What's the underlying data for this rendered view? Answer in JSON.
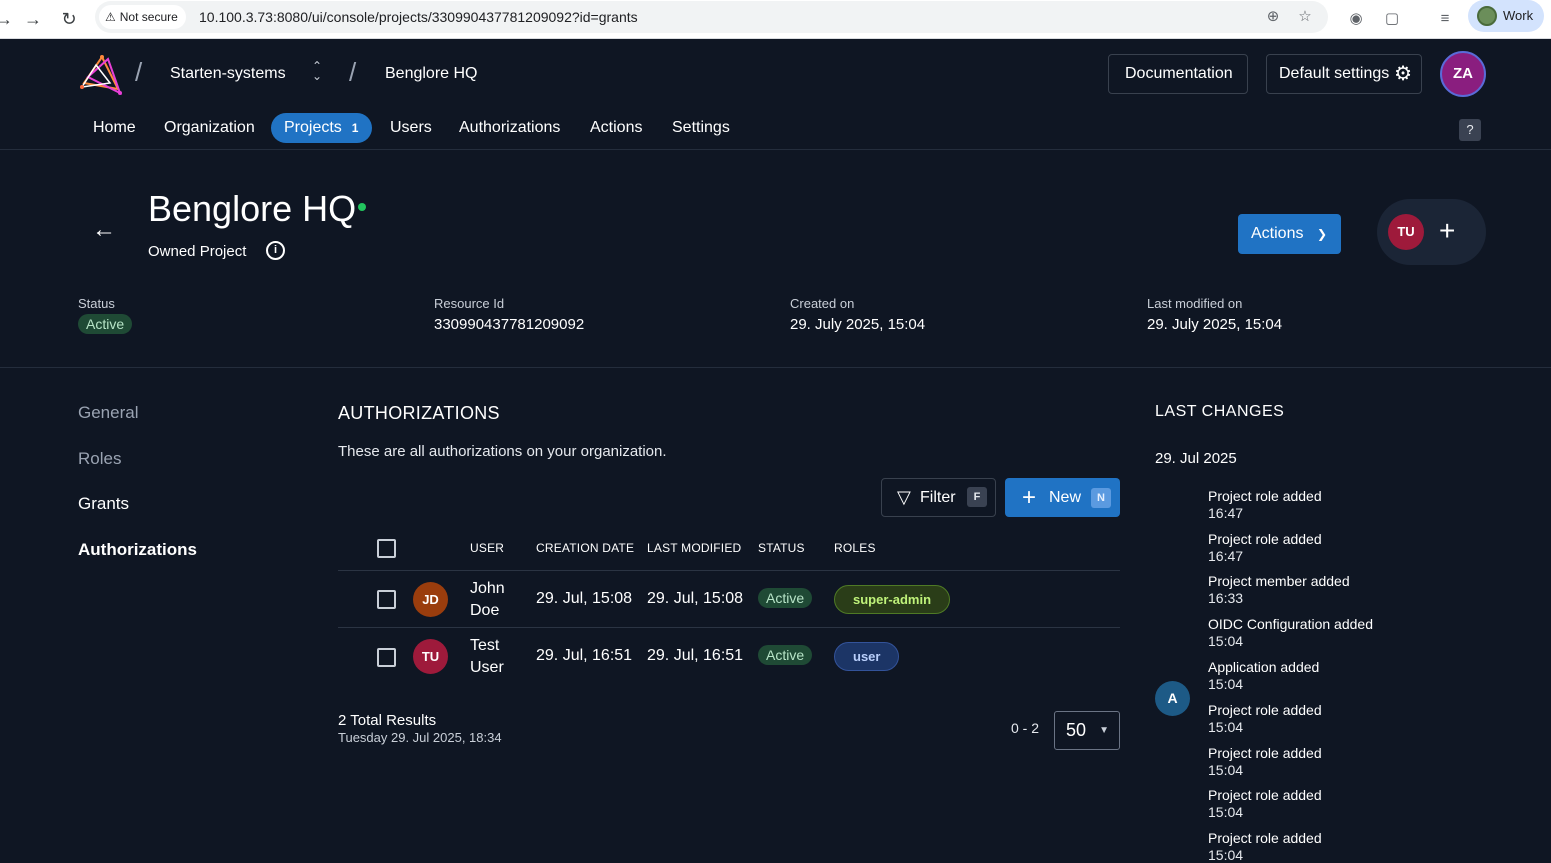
{
  "browser": {
    "security_label": "Not secure",
    "url": "10.100.3.73:8080/ui/console/projects/330990437781209092?id=grants",
    "profile_label": "Work"
  },
  "header": {
    "organization": "Starten-systems",
    "project": "Benglore HQ",
    "documentation_label": "Documentation",
    "default_settings_label": "Default settings",
    "user_initials": "ZA",
    "help_label": "?"
  },
  "mainnav": {
    "items": [
      {
        "label": "Home"
      },
      {
        "label": "Organization"
      },
      {
        "label": "Projects",
        "badge": "1"
      },
      {
        "label": "Users"
      },
      {
        "label": "Authorizations"
      },
      {
        "label": "Actions"
      },
      {
        "label": "Settings"
      }
    ]
  },
  "project": {
    "title": "Benglore HQ",
    "subtitle": "Owned Project",
    "actions_label": "Actions",
    "member_initials": "TU",
    "meta": {
      "status_label": "Status",
      "status_value": "Active",
      "resource_label": "Resource Id",
      "resource_value": "330990437781209092",
      "created_label": "Created on",
      "created_value": "29. July 2025, 15:04",
      "modified_label": "Last modified on",
      "modified_value": "29. July 2025, 15:04"
    }
  },
  "sidenav": {
    "items": [
      "General",
      "Roles",
      "Grants",
      "Authorizations"
    ]
  },
  "authorizations": {
    "title": "AUTHORIZATIONS",
    "description": "These are all authorizations on your organization.",
    "filter_label": "Filter",
    "filter_key": "F",
    "new_label": "New",
    "new_key": "N",
    "columns": {
      "user": "USER",
      "creation_date": "CREATION DATE",
      "last_modified": "LAST MODIFIED",
      "status": "STATUS",
      "roles": "ROLES"
    },
    "rows": [
      {
        "initials": "JD",
        "name_first": "John",
        "name_last": "Doe",
        "creation_date": "29. Jul, 15:08",
        "last_modified": "29. Jul, 15:08",
        "status": "Active",
        "role": "super-admin",
        "avatar_color": "#9a3d0d"
      },
      {
        "initials": "TU",
        "name_first": "Test",
        "name_last": "User",
        "creation_date": "29. Jul, 16:51",
        "last_modified": "29. Jul, 16:51",
        "status": "Active",
        "role": "user",
        "avatar_color": "#9e1a3b"
      }
    ],
    "total_results": "2 Total Results",
    "total_date": "Tuesday 29. Jul 2025, 18:34",
    "range": "0 - 2",
    "page_size": "50"
  },
  "last_changes": {
    "title": "LAST CHANGES",
    "date": "29. Jul 2025",
    "avatar_initials": "A",
    "items": [
      {
        "text": "Project role added",
        "time": "16:47"
      },
      {
        "text": "Project role added",
        "time": "16:47"
      },
      {
        "text": "Project member added",
        "time": "16:33"
      },
      {
        "text": "OIDC Configuration added",
        "time": "15:04"
      },
      {
        "text": "Application added",
        "time": "15:04"
      },
      {
        "text": "Project role added",
        "time": "15:04"
      },
      {
        "text": "Project role added",
        "time": "15:04"
      },
      {
        "text": "Project role added",
        "time": "15:04"
      },
      {
        "text": "Project role added",
        "time": "15:04"
      }
    ]
  }
}
